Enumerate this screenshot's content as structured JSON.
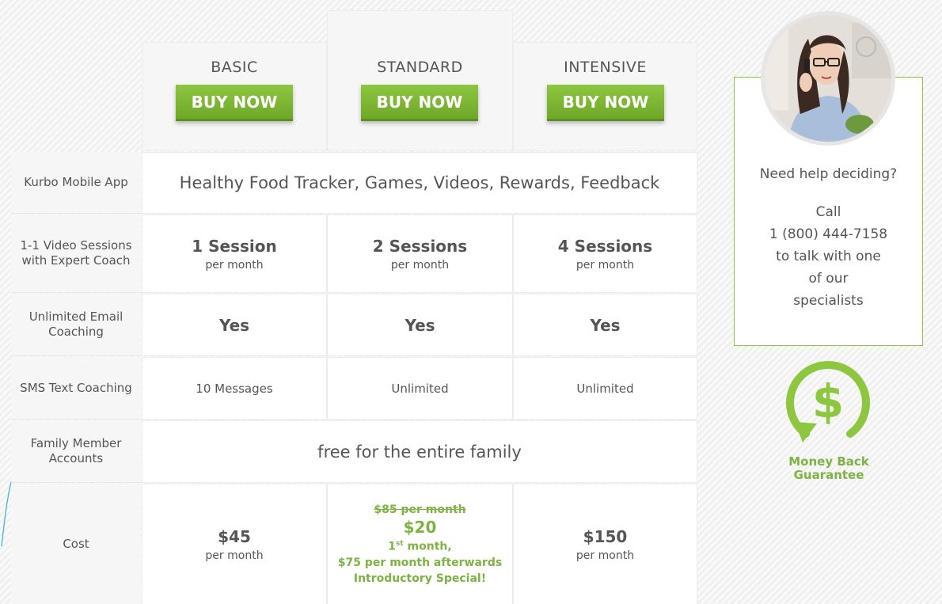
{
  "plans": [
    {
      "name": "BASIC",
      "button": "BUY NOW"
    },
    {
      "name": "STANDARD",
      "button": "BUY NOW"
    },
    {
      "name": "INTENSIVE",
      "button": "BUY NOW"
    }
  ],
  "rows": {
    "app": {
      "label": "Kurbo Mobile App",
      "value": "Healthy Food Tracker, Games, Videos, Rewards, Feedback"
    },
    "video": {
      "label": "1-1 Video Sessions with Expert Coach",
      "values": [
        "1 Session",
        "2 Sessions",
        "4 Sessions"
      ],
      "unit": "per month"
    },
    "email": {
      "label": "Unlimited Email Coaching",
      "values": [
        "Yes",
        "Yes",
        "Yes"
      ]
    },
    "sms": {
      "label": "SMS Text Coaching",
      "values": [
        "10 Messages",
        "Unlimited",
        "Unlimited"
      ]
    },
    "family": {
      "label": "Family Member Accounts",
      "value": "free for the entire family"
    },
    "cost": {
      "label": "Cost",
      "basic": {
        "price": "$45",
        "unit": "per month"
      },
      "standard": {
        "old_price": "$85 per month",
        "price": "$20",
        "first_a": "1",
        "first_sup": "st",
        "first_b": " month,",
        "after": "$75 per month afterwards",
        "special": "Introductory Special!"
      },
      "intensive": {
        "price": "$150",
        "unit": "per month"
      }
    }
  },
  "help": {
    "question": "Need help deciding?",
    "call": "Call",
    "phone": "1 (800) 444-7158",
    "line1": "to talk with one",
    "line2": "of our",
    "line3": "specialists"
  },
  "guarantee": {
    "line1": "Money Back",
    "line2": "Guarantee"
  },
  "colors": {
    "accent": "#8dc63f",
    "accent_text": "#7cb342",
    "button_dark": "#6fa829"
  },
  "icons": {
    "guarantee": "dollar-refresh-icon",
    "avatar": "support-agent-photo"
  }
}
